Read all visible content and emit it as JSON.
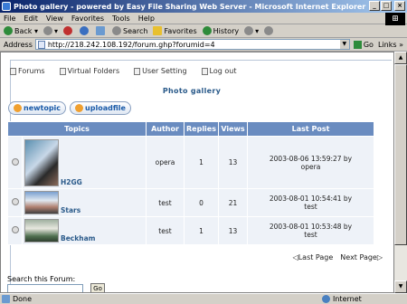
{
  "window": {
    "title": "Photo gallery - powered by Easy File Sharing Web Server - Microsoft Internet Explorer"
  },
  "menubar": [
    "File",
    "Edit",
    "View",
    "Favorites",
    "Tools",
    "Help"
  ],
  "toolbar": {
    "back": "Back",
    "search": "Search",
    "favorites": "Favorites",
    "history": "History"
  },
  "address": {
    "label": "Address",
    "url": "http://218.242.108.192/forum.ghp?forumid=4",
    "go": "Go",
    "links": "Links"
  },
  "forum": {
    "nav": [
      "Forums",
      "Virtual Folders",
      "User Setting",
      "Log out"
    ],
    "title": "Photo gallery",
    "buttons": {
      "new_topic": "newtopic",
      "upload_file": "uploadfile"
    },
    "columns": [
      "Topics",
      "Author",
      "Replies",
      "Views",
      "Last Post"
    ],
    "rows": [
      {
        "topic": "H2GG",
        "author": "opera",
        "replies": "1",
        "views": "13",
        "last_post_date": "2003-08-06 13:59:27 by",
        "last_post_user": "opera"
      },
      {
        "topic": "Stars",
        "author": "test",
        "replies": "0",
        "views": "21",
        "last_post_date": "2003-08-01 10:54:41 by",
        "last_post_user": "test"
      },
      {
        "topic": "Beckham",
        "author": "test",
        "replies": "1",
        "views": "13",
        "last_post_date": "2003-08-01 10:53:48 by",
        "last_post_user": "test"
      }
    ],
    "pagination": {
      "last": "Last Page",
      "next": "Next Page"
    },
    "search": {
      "label": "Search this Forum:",
      "value": "",
      "go": "Go"
    }
  },
  "status": {
    "text": "Done",
    "zone": "Internet"
  }
}
